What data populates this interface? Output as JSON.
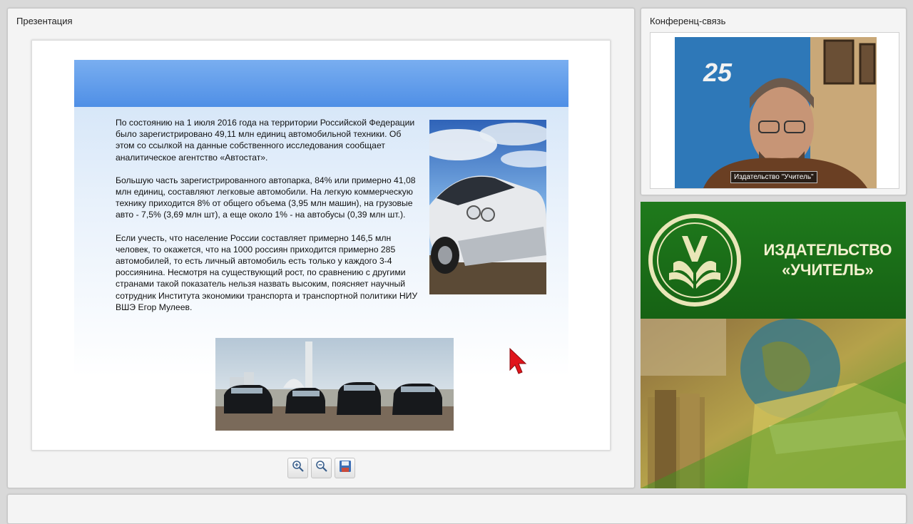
{
  "presentation": {
    "title": "Презентация",
    "slide": {
      "paragraphs": [
        "По состоянию на 1 июля 2016 года на территории Российской Федерации было зарегистрировано 49,11 млн единиц автомобильной техники. Об этом со ссылкой на данные собственного исследования сообщает аналитическое агентство «Автостат».",
        "Большую часть зарегистрированного автопарка, 84% или примерно 41,08 млн единиц, составляют легковые автомобили. На легкую коммерческую технику приходится 8% от общего объема (3,95 млн машин), на грузовые авто - 7,5% (3,69 млн шт), а еще около 1% - на автобусы (0,39 млн шт.).",
        "Если учесть, что население России составляет примерно 146,5 млн человек, то окажется, что на 1000 россиян приходится примерно 285 автомобилей, то есть личный автомобиль есть только у каждого 3-4 россиянина. Несмотря на существующий рост, по сравнению с другими странами такой показатель нельзя назвать высоким, поясняет научный сотрудник Института экономики транспорта и транспортной политики НИУ ВШЭ Егор Мулеев."
      ]
    },
    "toolbar": {
      "zoom_in_icon": "zoom-in-icon",
      "zoom_out_icon": "zoom-out-icon",
      "save_icon": "floppy-disk-icon"
    }
  },
  "conference": {
    "title": "Конференц-связь",
    "speaker_caption": "Издательство \"Учитель\""
  },
  "banner": {
    "title_line1": "ИЗДАТЕЛЬСТВО",
    "title_line2": "«УЧИТЕЛЬ»"
  },
  "colors": {
    "banner_green": "#1b6e19",
    "slide_header_blue": "#5b98e9",
    "cursor_red": "#e0141b"
  }
}
